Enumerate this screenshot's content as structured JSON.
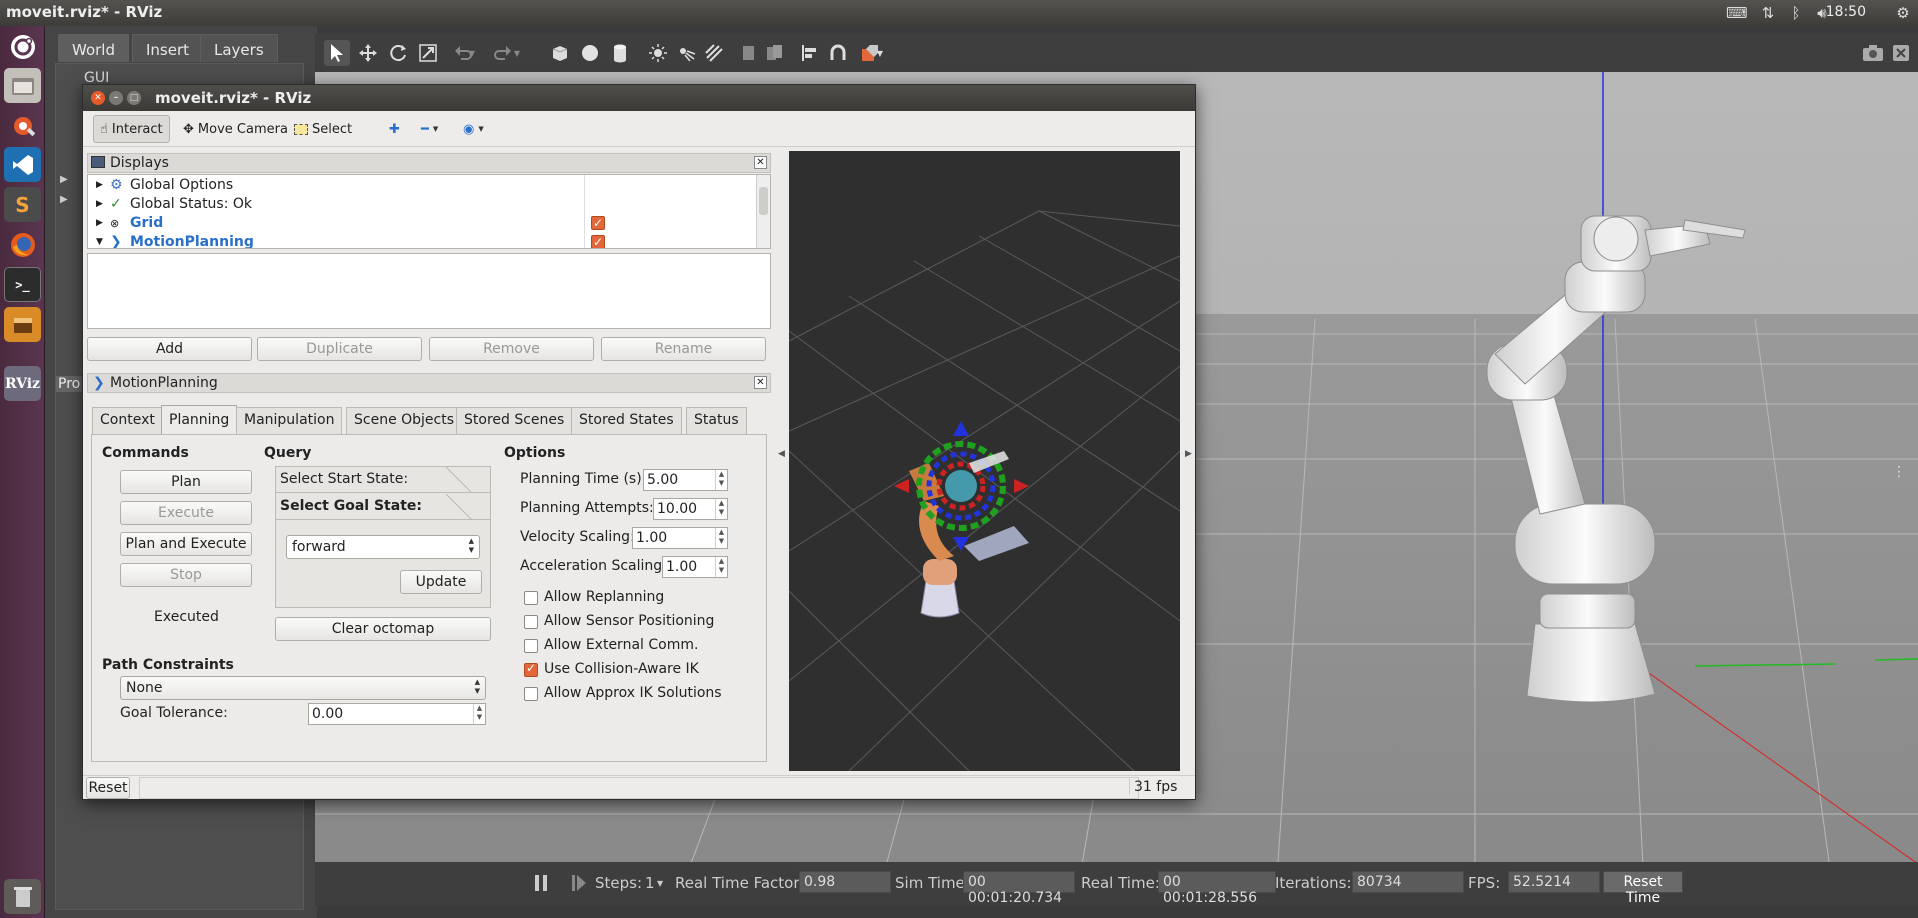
{
  "topbar": {
    "title": "moveit.rviz* - RViz",
    "clock": "18:50"
  },
  "launcher": {
    "rviz_label": "RViz"
  },
  "gazebo": {
    "tabs": [
      "World",
      "Insert",
      "Layers"
    ],
    "panel_item": "GUI",
    "clipped_label": "Pro",
    "bottom": {
      "steps_label": "Steps:",
      "steps_value": "1",
      "rtf_label": "Real Time Factor:",
      "rtf_value": "0.98",
      "sim_label": "Sim Time:",
      "sim_value": "00 00:01:20.734",
      "real_label": "Real Time:",
      "real_value": "00 00:01:28.556",
      "iter_label": "Iterations:",
      "iter_value": "80734",
      "fps_label": "FPS:",
      "fps_value": "52.5214",
      "reset_label": "Reset Time"
    }
  },
  "rviz": {
    "title": "moveit.rviz* - RViz",
    "toolbar": {
      "interact": "Interact",
      "move_camera": "Move Camera",
      "select": "Select"
    },
    "displays": {
      "title": "Displays",
      "items": [
        {
          "label": "Global Options"
        },
        {
          "label": "Global Status: Ok"
        },
        {
          "label": "Grid",
          "checked": true
        },
        {
          "label": "MotionPlanning",
          "checked": true
        }
      ],
      "buttons": [
        "Add",
        "Duplicate",
        "Remove",
        "Rename"
      ]
    },
    "motion_planning": {
      "title": "MotionPlanning",
      "tabs": [
        "Context",
        "Planning",
        "Manipulation",
        "Scene Objects",
        "Stored Scenes",
        "Stored States",
        "Status"
      ],
      "active_tab": "Planning",
      "commands": {
        "title": "Commands",
        "plan": "Plan",
        "execute": "Execute",
        "plan_execute": "Plan and Execute",
        "stop": "Stop",
        "status": "Executed"
      },
      "query": {
        "title": "Query",
        "start_state": "Select Start State:",
        "goal_state": "Select Goal State:",
        "goal_value": "forward",
        "update": "Update",
        "clear_octomap": "Clear octomap"
      },
      "options": {
        "title": "Options",
        "planning_time_label": "Planning Time (s):",
        "planning_time": "5.00",
        "planning_attempts_label": "Planning Attempts:",
        "planning_attempts": "10.00",
        "velocity_label": "Velocity Scaling:",
        "velocity": "1.00",
        "accel_label": "Acceleration Scaling:",
        "accel": "1.00",
        "checkboxes": [
          {
            "label": "Allow Replanning",
            "checked": false
          },
          {
            "label": "Allow Sensor Positioning",
            "checked": false
          },
          {
            "label": "Allow External Comm.",
            "checked": false
          },
          {
            "label": "Use Collision-Aware IK",
            "checked": true
          },
          {
            "label": "Allow Approx IK Solutions",
            "checked": false
          }
        ]
      },
      "path_constraints": {
        "title": "Path Constraints",
        "value": "None",
        "goal_tolerance_label": "Goal Tolerance:",
        "goal_tolerance": "0.00"
      }
    },
    "status": {
      "reset": "Reset",
      "fps": "31 fps"
    }
  }
}
